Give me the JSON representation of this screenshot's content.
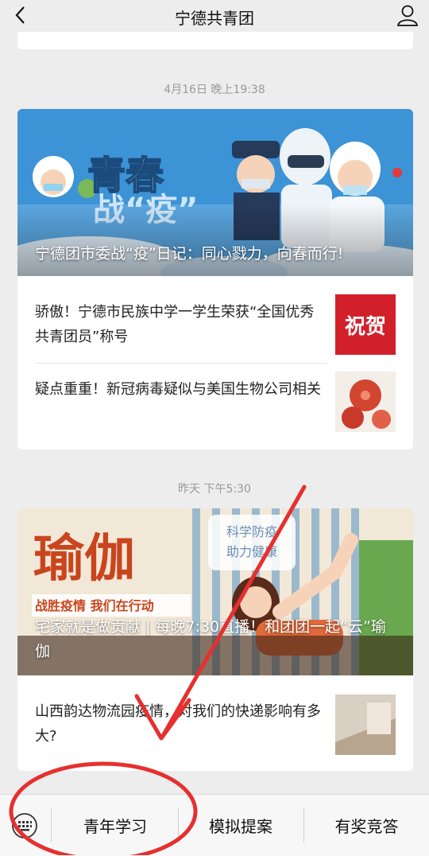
{
  "header": {
    "title": "宁德共青团"
  },
  "feed": [
    {
      "time": "4月16日 晚上19:38",
      "hero": {
        "title": "宁德团市委战“疫”日记：同心戮力，向春而行!",
        "art_text_1": "青春",
        "art_text_2": "战“疫”"
      },
      "items": [
        {
          "title": "骄傲！宁德市民族中学一学生荣获“全国优秀共青团员”称号",
          "thumb_text": "祝贺"
        },
        {
          "title": "疑点重重！新冠病毒疑似与美国生物公司相关"
        }
      ]
    },
    {
      "time": "昨天 下午5:30",
      "hero": {
        "title": "宅家就是做贡献 | 每晚7:30直播！和团团一起“云”瑜伽",
        "art_text_1": "瑜伽",
        "art_text_2": "科学防疫",
        "art_text_3": "助力健康",
        "art_text_4": "战胜疫情 我们在行动"
      },
      "items": [
        {
          "title": "山西韵达物流园疫情，对我们的快递影响有多大?"
        }
      ]
    }
  ],
  "menu": {
    "items": [
      "青年学习",
      "模拟提案",
      "有奖竞答"
    ]
  },
  "colors": {
    "annotation_red": "#e5302f",
    "brand_red": "#d2202a",
    "sky_blue": "#3c93d6"
  }
}
